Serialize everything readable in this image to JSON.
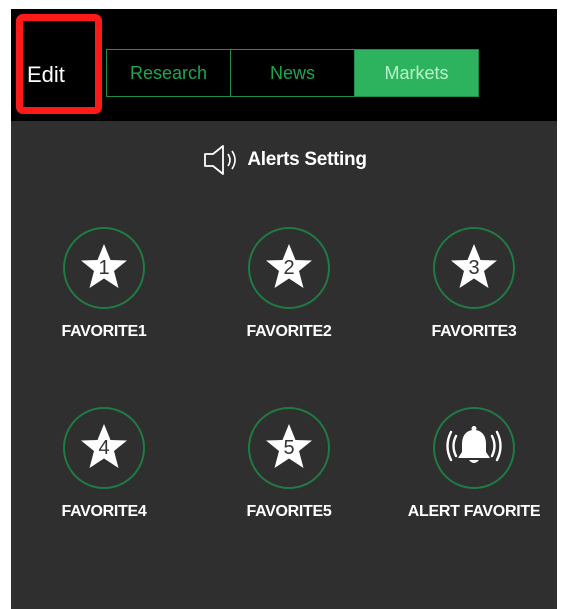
{
  "header": {
    "edit_label": "Edit",
    "tabs": [
      {
        "label": "Research",
        "active": false
      },
      {
        "label": "News",
        "active": false
      },
      {
        "label": "Markets",
        "active": true
      }
    ]
  },
  "alerts_setting": {
    "label": "Alerts Setting",
    "icon": "speaker-icon"
  },
  "favorites": [
    {
      "label": "FAVORITE1",
      "number": "1",
      "icon": "star-icon"
    },
    {
      "label": "FAVORITE2",
      "number": "2",
      "icon": "star-icon"
    },
    {
      "label": "FAVORITE3",
      "number": "3",
      "icon": "star-icon"
    },
    {
      "label": "FAVORITE4",
      "number": "4",
      "icon": "star-icon"
    },
    {
      "label": "FAVORITE5",
      "number": "5",
      "icon": "star-icon"
    },
    {
      "label": "ALERT FAVORITE",
      "number": "",
      "icon": "bell-icon"
    }
  ],
  "colors": {
    "accent_green": "#2db35e",
    "tab_text_green": "#1ea653",
    "background": "#2f2f2f",
    "highlight_red": "#ff1a1a"
  }
}
